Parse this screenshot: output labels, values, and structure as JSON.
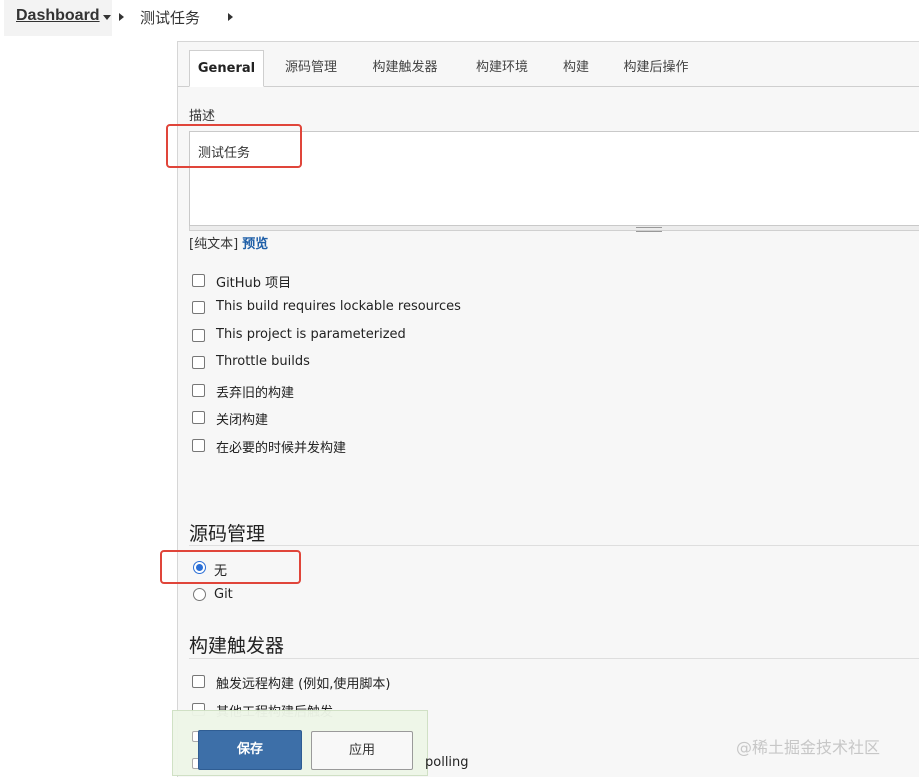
{
  "breadcrumb": {
    "root": "Dashboard",
    "job": "测试任务"
  },
  "tabs": [
    "General",
    "源码管理",
    "构建触发器",
    "构建环境",
    "构建",
    "构建后操作"
  ],
  "general": {
    "description_label": "描述",
    "description_value": "测试任务",
    "format_prefix": "[纯文本]",
    "preview_link": "预览",
    "options": [
      "GitHub 项目",
      "This build requires lockable resources",
      "This project is parameterized",
      "Throttle builds",
      "丢弃旧的构建",
      "关闭构建",
      "在必要的时候并发构建"
    ]
  },
  "scm": {
    "title": "源码管理",
    "options": [
      "无",
      "Git"
    ],
    "selected": "无"
  },
  "triggers": {
    "title": "构建触发器",
    "options": [
      "触发远程构建 (例如,使用脚本)",
      "其他工程构建后触发"
    ],
    "partial_text": "polling"
  },
  "actions": {
    "save": "保存",
    "apply": "应用"
  },
  "watermark": "@稀土掘金技术社区",
  "colors": {
    "highlight": "#e0453a",
    "save_button": "#3d6fa8",
    "radio_selected": "#2b6fd6",
    "link": "#1f5fa8"
  }
}
